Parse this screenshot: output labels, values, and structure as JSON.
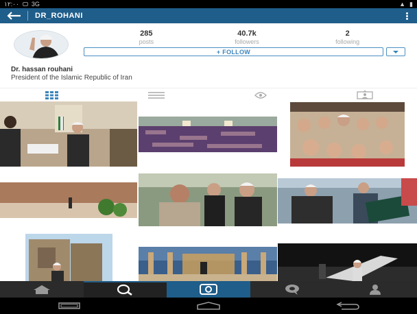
{
  "status_bar": {
    "time": "۱۲:۰۰",
    "network": "3G"
  },
  "header": {
    "username": "DR_ROHANI"
  },
  "stats": [
    {
      "value": "285",
      "label": "posts"
    },
    {
      "value": "40.7k",
      "label": "followers"
    },
    {
      "value": "2",
      "label": "following"
    }
  ],
  "follow": {
    "label": "+ FOLLOW"
  },
  "profile": {
    "name": "Dr. hassan rouhani",
    "bio": "President of the Islamic Republic of Iran"
  },
  "colors": {
    "brand": "#1f5d8a",
    "follow_accent": "#3b84bb",
    "nav_bg": "#2b2b2b"
  }
}
